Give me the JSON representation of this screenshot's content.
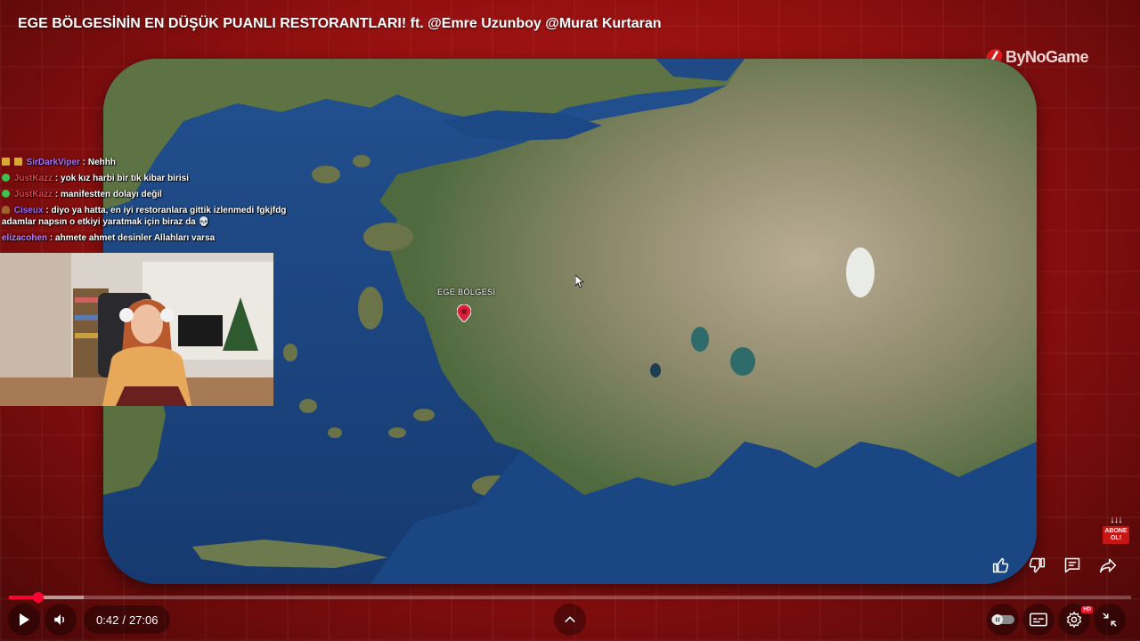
{
  "video": {
    "title": "EGE BÖLGESİNİN EN DÜŞÜK PUANLI RESTORANTLARI! ft. @Emre Uzunboy  @Murat Kurtaran",
    "brand": "ByNoGame"
  },
  "map": {
    "label": "EGE BÖLGESİ"
  },
  "chat": [
    {
      "badge": "badge-gold",
      "user": "SirDarkViper",
      "user_color": "#a970ff",
      "message": "Nehhh"
    },
    {
      "badge": "badge-green",
      "user": "JustKazz",
      "user_color": "#e0424a",
      "message": "yok kız harbi bir tık kibar birisi"
    },
    {
      "badge": "badge-green",
      "user": "JustKazz",
      "user_color": "#e0424a",
      "message": "manifestten dolayı değil"
    },
    {
      "badge": "badge-brown",
      "user": "Ciseux",
      "user_color": "#9f6cff",
      "message": "diyo ya hatta, en iyi restoranlara gittik izlenmedi fgkjfdg"
    },
    {
      "badge": "",
      "user": "",
      "user_color": "#ffffff",
      "message": "adamlar napsın o etkiyi yaratmak için biraz da 💀"
    },
    {
      "badge": "",
      "user": "elizacohen",
      "user_color": "#c27cff",
      "message": "ahmete ahmet desinler Allahları varsa"
    }
  ],
  "subscribe": {
    "arrows": "↓↓↓",
    "line1": "ABONE",
    "line2": "OL!"
  },
  "player": {
    "current_time": "0:42",
    "separator": "/",
    "duration": "27:06",
    "progress_fraction": 0.026,
    "buffer_fraction": 0.067,
    "quality_badge": "HD",
    "accent_color": "#ff0033"
  },
  "icons": {
    "like": "thumbs-up-icon",
    "dislike": "thumbs-down-icon",
    "comment": "comment-icon",
    "share": "share-icon",
    "play": "play-icon",
    "volume": "volume-icon",
    "chapters": "chevron-up-icon",
    "autoplay": "autoplay-toggle-icon",
    "captions": "captions-icon",
    "settings": "gear-icon",
    "exit_fullscreen": "exit-fullscreen-icon"
  }
}
